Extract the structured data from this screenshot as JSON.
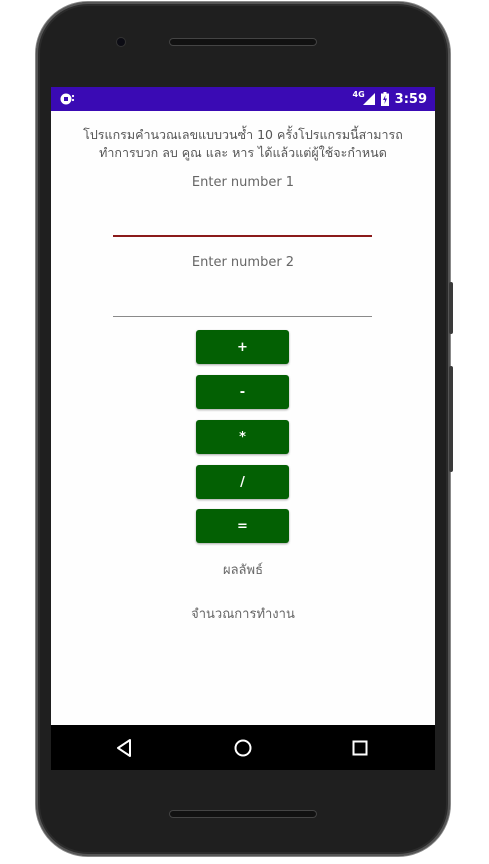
{
  "status_bar": {
    "network": "4G",
    "time": "3:59"
  },
  "app": {
    "intro_text": "โปรแกรมคำนวณเลขแบบวนซ้ำ 10 ครั้งโปรแกรมนี้สามารถทำการบวก ลบ คูณ และ หาร ได้แล้วแต่ผู้ใช้จะกำหนด",
    "number1_hint": "Enter number 1",
    "number2_hint": "Enter number 2",
    "number1_value": "",
    "number2_value": "",
    "buttons": {
      "add": "+",
      "subtract": "-",
      "multiply": "*",
      "divide": "/",
      "equals": "="
    },
    "result_label": "ผลลัพธ์",
    "count_label": "จำนวณการทำงาน"
  },
  "colors": {
    "status_bar": "#3a0ab4",
    "button": "#036003",
    "active_underline": "#8b1a1a",
    "inactive_underline": "#8a8a8a"
  },
  "icons": {
    "status_left": "notification-icon",
    "signal": "signal-icon",
    "battery": "battery-charging-icon",
    "nav_back": "back-icon",
    "nav_home": "home-icon",
    "nav_recents": "recents-icon"
  }
}
